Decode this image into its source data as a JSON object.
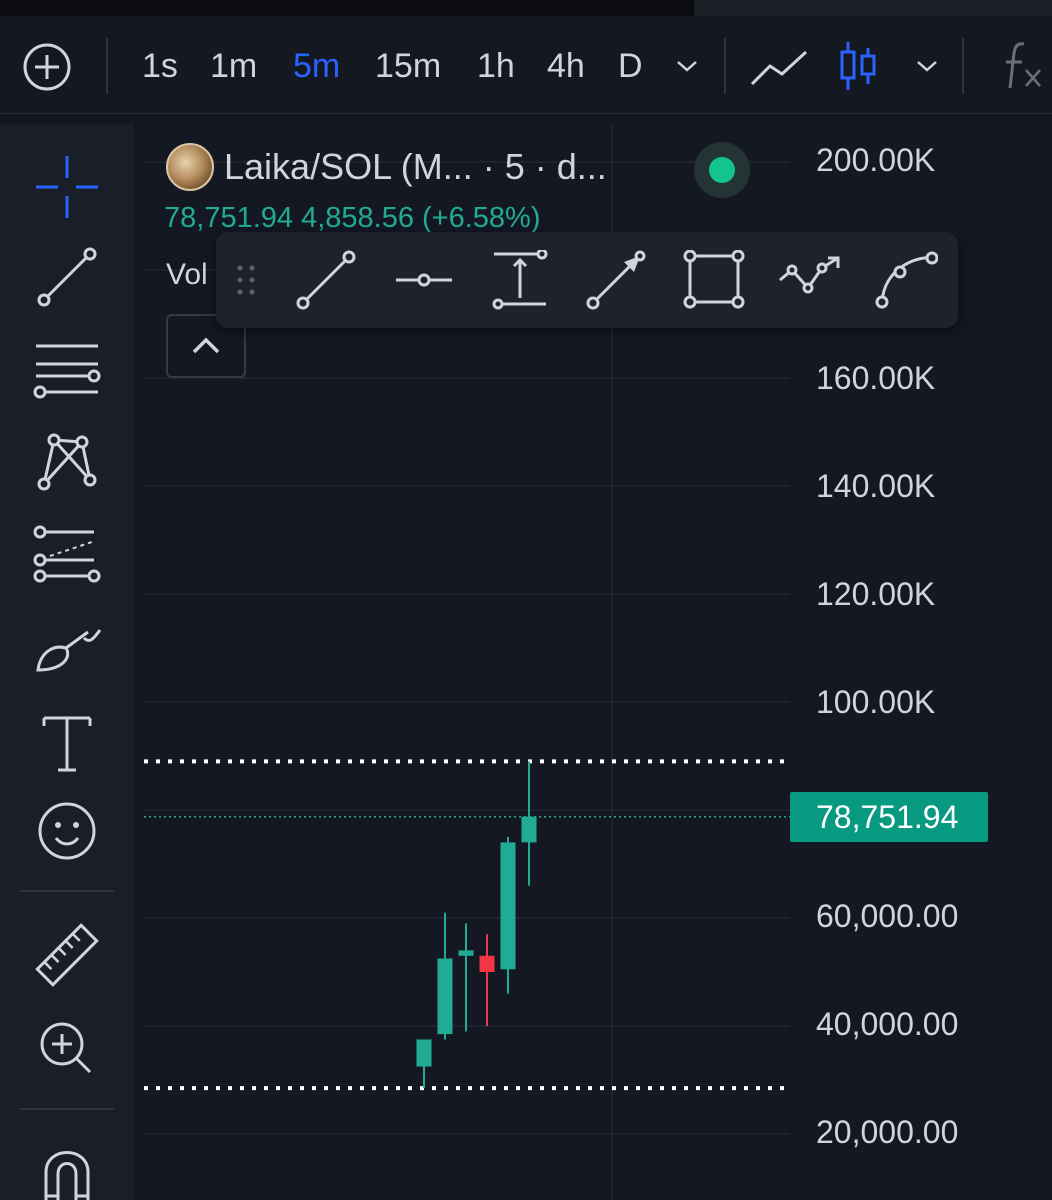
{
  "toolbar": {
    "timeframes": [
      {
        "label": "1s",
        "active": false
      },
      {
        "label": "1m",
        "active": false
      },
      {
        "label": "5m",
        "active": true
      },
      {
        "label": "15m",
        "active": false
      },
      {
        "label": "1h",
        "active": false
      },
      {
        "label": "4h",
        "active": false
      },
      {
        "label": "D",
        "active": false
      }
    ],
    "icons": [
      "add-circle-icon",
      "chevron-down-icon",
      "line-chart-icon",
      "candlestick-chart-icon",
      "chevron-down-icon",
      "indicators-fx-icon"
    ]
  },
  "sidebar": {
    "tools": [
      "crosshair-icon",
      "trend-line-icon",
      "horizontal-lines-icon",
      "pattern-icon",
      "fib-icon",
      "brush-icon",
      "text-icon",
      "emoji-icon",
      "ruler-icon",
      "zoom-in-icon",
      "magnet-icon"
    ]
  },
  "legend": {
    "symbol": "Laika/SOL (M...",
    "interval": "· 5 · d...",
    "ohlc": "78,751.94  4,858.56 (+6.58%)",
    "vol_label": "Vol"
  },
  "drawing_toolbar": {
    "icons": [
      "drag-handle-icon",
      "trend-line-icon",
      "horizontal-ray-icon",
      "price-range-icon",
      "arrow-line-icon",
      "rectangle-icon",
      "path-icon",
      "curve-icon"
    ]
  },
  "price_scale": {
    "labels": [
      "200.00K",
      "160.00K",
      "140.00K",
      "120.00K",
      "100.00K",
      "60,000.00",
      "40,000.00",
      "20,000.00"
    ],
    "last_price": "78,751.94"
  },
  "colors": {
    "up": "#22ab94",
    "down": "#f23645",
    "accent": "#2962ff",
    "live": "#12c58f",
    "last_price_bg": "#089981"
  },
  "chart_data": {
    "type": "candlestick",
    "ylim": [
      20000,
      200000
    ],
    "last_price": 78751.94,
    "horizontal_lines": [
      89000,
      28500
    ],
    "candles": [
      {
        "open": 32500,
        "high": 36500,
        "low": 28500,
        "close": 37500,
        "dir": "up"
      },
      {
        "open": 38500,
        "high": 61000,
        "low": 37500,
        "close": 52500,
        "dir": "up"
      },
      {
        "open": 53000,
        "high": 59000,
        "low": 39000,
        "close": 54000,
        "dir": "up"
      },
      {
        "open": 53000,
        "high": 57000,
        "low": 40000,
        "close": 50000,
        "dir": "down"
      },
      {
        "open": 50500,
        "high": 75000,
        "low": 46000,
        "close": 74000,
        "dir": "up"
      },
      {
        "open": 74000,
        "high": 89000,
        "low": 66000,
        "close": 78751.94,
        "dir": "up"
      }
    ]
  }
}
